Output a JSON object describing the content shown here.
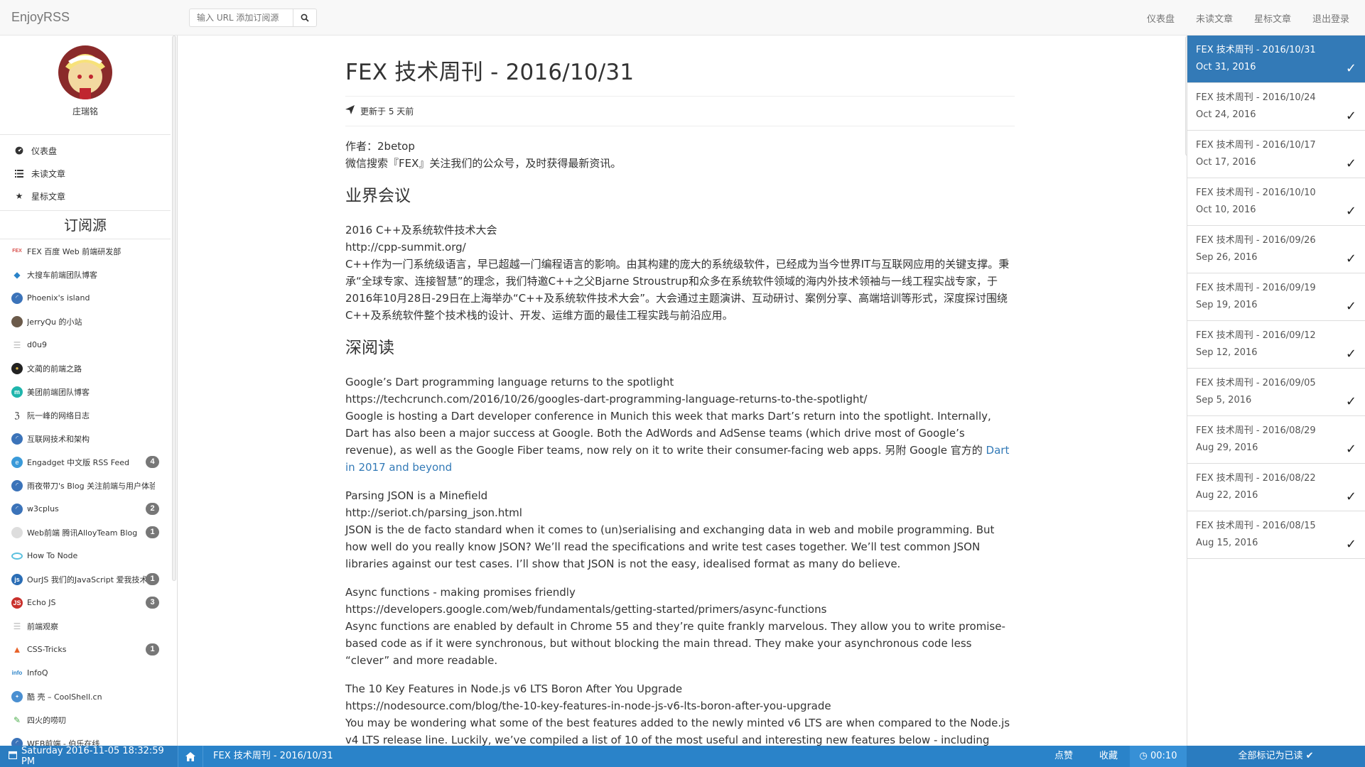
{
  "app": {
    "brand": "EnjoyRSS"
  },
  "search": {
    "placeholder": "输入 URL 添加订阅源"
  },
  "topnav": {
    "dashboard": "仪表盘",
    "unread": "未读文章",
    "starred": "星标文章",
    "logout": "退出登录"
  },
  "profile": {
    "username": "庄瑞铭"
  },
  "menu": {
    "dashboard": "仪表盘",
    "unread": "未读文章",
    "starred": "星标文章"
  },
  "feeds_title": "订阅源",
  "feeds": [
    {
      "name": "FEX 百度 Web 前端研发部",
      "icon": "fex-icon",
      "badge": ""
    },
    {
      "name": "大搜车前端团队博客",
      "icon": "diamond-icon",
      "badge": ""
    },
    {
      "name": "Phoenix's island",
      "icon": "rss-icon",
      "badge": ""
    },
    {
      "name": "JerryQu 的小站",
      "icon": "avatar-icon",
      "badge": ""
    },
    {
      "name": "d0u9",
      "icon": "list-icon",
      "badge": ""
    },
    {
      "name": "文蔺的前端之路",
      "icon": "dark-circle-icon",
      "badge": ""
    },
    {
      "name": "美团前端团队博客",
      "icon": "meituan-icon",
      "badge": ""
    },
    {
      "name": "阮一峰的网络日志",
      "icon": "runner-icon",
      "badge": ""
    },
    {
      "name": "互联网技术和架构",
      "icon": "rss-icon",
      "badge": ""
    },
    {
      "name": "Engadget 中文版 RSS Feed",
      "icon": "engadget-icon",
      "badge": "4"
    },
    {
      "name": "雨夜带刀's Blog 关注前端与用户体验",
      "icon": "rss-icon",
      "badge": ""
    },
    {
      "name": "w3cplus",
      "icon": "rss-icon",
      "badge": "2"
    },
    {
      "name": "Web前端 腾讯AlloyTeam Blog",
      "icon": "alloy-icon",
      "badge": "1"
    },
    {
      "name": "How To Node",
      "icon": "ring-icon",
      "badge": ""
    },
    {
      "name": "OurJS 我们的JavaScript 爱我技术",
      "icon": "ourjs-icon",
      "badge": "1"
    },
    {
      "name": "Echo JS",
      "icon": "echojs-icon",
      "badge": "3"
    },
    {
      "name": "前端观察",
      "icon": "list-icon",
      "badge": ""
    },
    {
      "name": "CSS-Tricks",
      "icon": "flame-icon",
      "badge": "1"
    },
    {
      "name": "InfoQ",
      "icon": "infoq-icon",
      "badge": ""
    },
    {
      "name": "酷 壳 – CoolShell.cn",
      "icon": "coolshell-icon",
      "badge": ""
    },
    {
      "name": "四火的唠叨",
      "icon": "leaf-icon",
      "badge": ""
    },
    {
      "name": "WEB前端 - 伯乐在线",
      "icon": "rss-icon",
      "badge": ""
    }
  ],
  "article": {
    "title": "FEX 技术周刊 - 2016/10/31",
    "updated": "更新于 5 天前",
    "author": "作者：2betop",
    "wechat": "微信搜索『FEX』关注我们的公众号，及时获得最新资讯。",
    "h_conf": "业界会议",
    "conf_title": "2016 C++及系统软件技术大会",
    "conf_url": "http://cpp-summit.org/",
    "conf_desc": "C++作为一门系统级语言，早已超越一门编程语言的影响。由其构建的庞大的系统级软件，已经成为当今世界IT与互联网应用的关键支撑。秉承“全球专家、连接智慧”的理念，我们特邀C++之父Bjarne Stroustrup和众多在系统软件领域的海内外技术领袖与一线工程实战专家，于2016年10月28日-29日在上海举办“C++及系统软件技术大会”。大会通过主题演讲、互动研讨、案例分享、高端培训等形式，深度探讨围绕C++及系统软件整个技术栈的设计、开发、运维方面的最佳工程实践与前沿应用。",
    "h_read": "深阅读",
    "items": [
      {
        "title": "Google’s Dart programming language returns to the spotlight",
        "url": "https://techcrunch.com/2016/10/26/googles-dart-programming-language-returns-to-the-spotlight/",
        "desc": "Google is hosting a Dart developer conference in Munich this week that marks Dart’s return into the spotlight. Internally, Dart has also been a major success at Google. Both the AdWords and AdSense teams (which drive most of Google’s revenue), as well as the Google Fiber teams, now rely on it to write their consumer-facing web apps. 另附 Google 官方的 ",
        "link": "Dart in 2017 and beyond"
      },
      {
        "title": "Parsing JSON is a Minefield",
        "url": "http://seriot.ch/parsing_json.html",
        "desc": "JSON is the de facto standard when it comes to (un)serialising and exchanging data in web and mobile programming. But how well do you really know JSON? We’ll read the specifications and write test cases together. We’ll test common JSON libraries against our test cases. I’ll show that JSON is not the easy, idealised format as many do believe.",
        "link": ""
      },
      {
        "title": "Async functions - making promises friendly",
        "url": "https://developers.google.com/web/fundamentals/getting-started/primers/async-functions",
        "desc": "Async functions are enabled by default in Chrome 55 and they’re quite frankly marvelous. They allow you to write promise-based code as if it were synchronous, but without blocking the main thread. They make your asynchronous code less “clever” and more readable.",
        "link": ""
      },
      {
        "title": "The 10 Key Features in Node.js v6 LTS Boron After You Upgrade",
        "url": "https://nodesource.com/blog/the-10-key-features-in-node-js-v6-lts-boron-after-you-upgrade",
        "desc": "You may be wondering what some of the best features added to the newly minted v6 LTS are when compared to the Node.js v4 LTS release line. Luckily, we’ve compiled a list of 10 of the most useful and interesting new features below - including some highlights like the DevTools Inspector, unhandled Promise rejection warnings, and the Process Warnings API.另附非常重要",
        "link": ""
      }
    ]
  },
  "right_list": [
    {
      "title": "FEX 技术周刊 - 2016/10/31",
      "date": "Oct 31, 2016",
      "active": true
    },
    {
      "title": "FEX 技术周刊 - 2016/10/24",
      "date": "Oct 24, 2016",
      "active": false
    },
    {
      "title": "FEX 技术周刊 - 2016/10/17",
      "date": "Oct 17, 2016",
      "active": false
    },
    {
      "title": "FEX 技术周刊 - 2016/10/10",
      "date": "Oct 10, 2016",
      "active": false
    },
    {
      "title": "FEX 技术周刊 - 2016/09/26",
      "date": "Sep 26, 2016",
      "active": false
    },
    {
      "title": "FEX 技术周刊 - 2016/09/19",
      "date": "Sep 19, 2016",
      "active": false
    },
    {
      "title": "FEX 技术周刊 - 2016/09/12",
      "date": "Sep 12, 2016",
      "active": false
    },
    {
      "title": "FEX 技术周刊 - 2016/09/05",
      "date": "Sep 5, 2016",
      "active": false
    },
    {
      "title": "FEX 技术周刊 - 2016/08/29",
      "date": "Aug 29, 2016",
      "active": false
    },
    {
      "title": "FEX 技术周刊 - 2016/08/22",
      "date": "Aug 22, 2016",
      "active": false
    },
    {
      "title": "FEX 技术周刊 - 2016/08/15",
      "date": "Aug 15, 2016",
      "active": false
    }
  ],
  "bottom": {
    "datetime": "Saturday 2016-11-05 18:32:59 PM",
    "current_title": "FEX 技术周刊 - 2016/10/31",
    "like": "点赞",
    "favorite": "收藏",
    "timer": "00:10",
    "mark_all": "全部标记为已读"
  },
  "colors": {
    "accent": "#337ab7",
    "bottom_bar": "#2a83c9",
    "badge": "#777777"
  }
}
